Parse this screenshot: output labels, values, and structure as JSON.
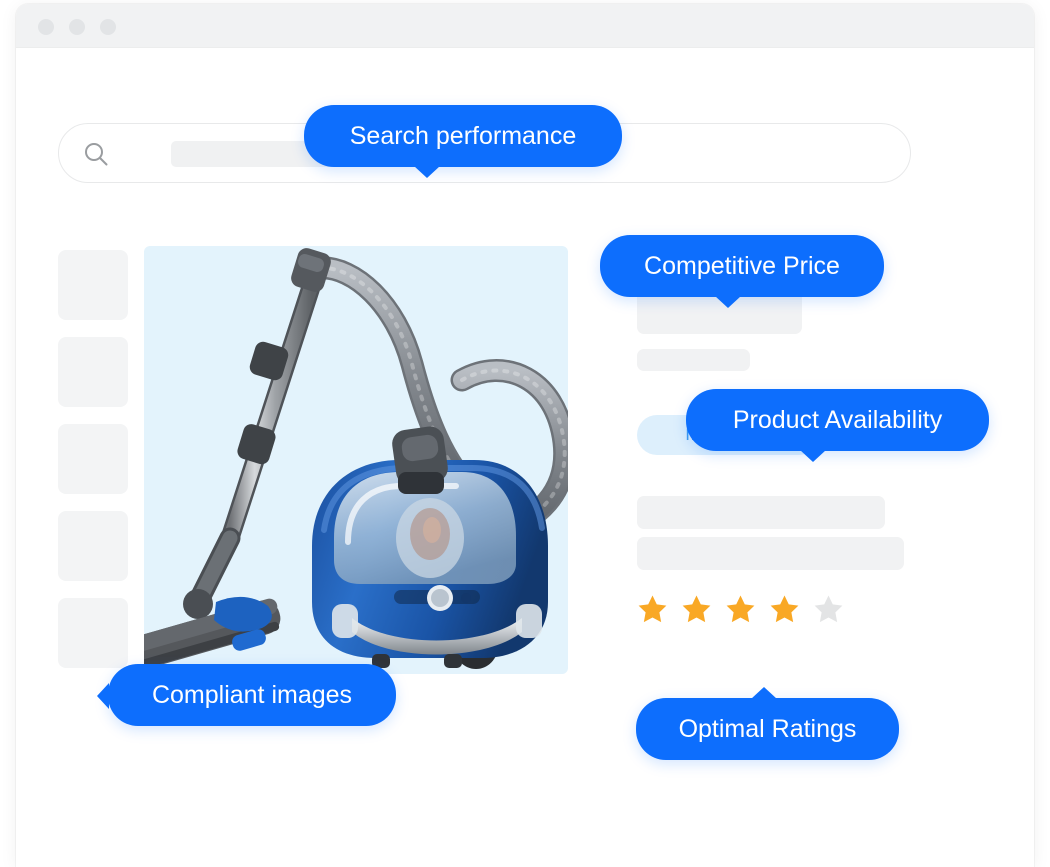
{
  "window": {
    "traffic_lights": [
      "close-dot",
      "minimize-dot",
      "maximize-dot"
    ]
  },
  "search": {
    "icon": "search-icon",
    "value": "",
    "placeholder": ""
  },
  "gallery": {
    "thumbnail_count": 5,
    "thumbnails": [
      "thumbnail-1",
      "thumbnail-2",
      "thumbnail-3",
      "thumbnail-4",
      "thumbnail-5"
    ],
    "hero": {
      "alt": "blue canister vacuum cleaner",
      "background_color": "#e3f3fc"
    }
  },
  "details": {
    "price_placeholder": "",
    "bar_thin_placeholder": "",
    "availability_badge": "IN STOCK",
    "availability_badge_color": "#3f9bf0",
    "availability_badge_bg": "#ddeffc",
    "description_bar_1": "",
    "description_bar_2": "",
    "rating": {
      "value": 4,
      "max": 5,
      "filled_color": "#f9a825",
      "empty_color": "#e3e4e5"
    }
  },
  "tooltips": {
    "search_performance": "Search performance",
    "competitive_price": "Competitive Price",
    "product_availability": "Product Availability",
    "optimal_ratings": "Optimal Ratings",
    "compliant_images": "Compliant images",
    "accent_color": "#0d6efd"
  }
}
